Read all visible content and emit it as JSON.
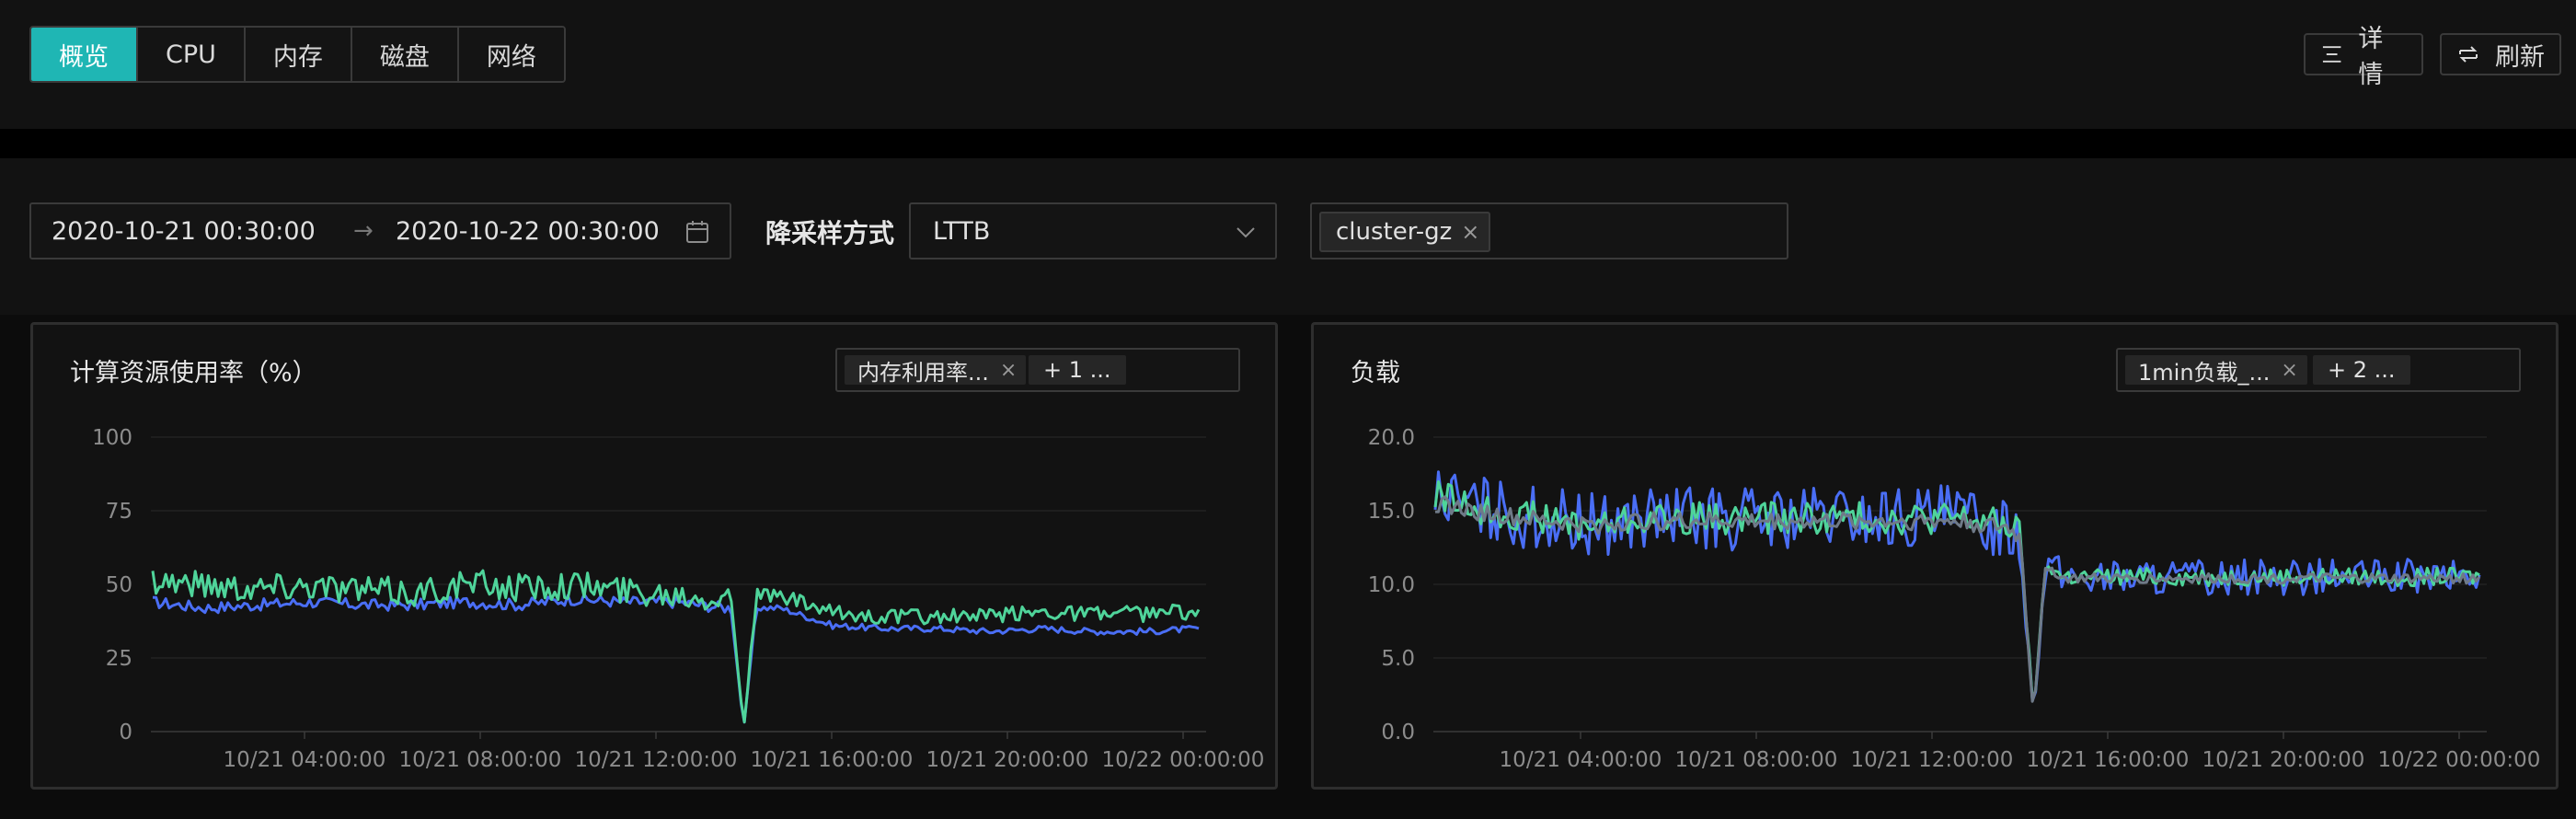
{
  "tabs": [
    {
      "label": "概览",
      "active": true
    },
    {
      "label": "CPU",
      "active": false
    },
    {
      "label": "内存",
      "active": false
    },
    {
      "label": "磁盘",
      "active": false
    },
    {
      "label": "网络",
      "active": false
    }
  ],
  "actions": {
    "detail_label": "详情",
    "refresh_label": "刷新"
  },
  "filters": {
    "start": "2020-10-21 00:30:00",
    "arrow": "→",
    "end": "2020-10-22 00:30:00",
    "sampling_label": "降采样方式",
    "sampling_value": "LTTB",
    "cluster_tag": "cluster-gz"
  },
  "colors": {
    "accent": "#1fb6b4",
    "blue": "#4a6ef5",
    "green": "#4fd49a",
    "gray": "#6f7a88"
  },
  "chart_data": [
    {
      "type": "line",
      "title": "计算资源使用率（%）",
      "metric_tag": "内存利用率...",
      "more_tag": "+ 1 ...",
      "x_ticks": [
        "10/21 04:00:00",
        "10/21 08:00:00",
        "10/21 12:00:00",
        "10/21 16:00:00",
        "10/21 20:00:00",
        "10/22 00:00:00"
      ],
      "y_ticks": [
        "100",
        "75",
        "50",
        "25",
        "0"
      ],
      "ylim": [
        0,
        100
      ],
      "series": [
        {
          "color": "#4a6ef5",
          "base": [
            44,
            42,
            43,
            44,
            43,
            43,
            44,
            43,
            45,
            44,
            44,
            42,
            42,
            36,
            35,
            35,
            34,
            35,
            34,
            34,
            35
          ],
          "noise": 2
        },
        {
          "color": "#4fd49a",
          "base": [
            52,
            50,
            49,
            50,
            48,
            47,
            50,
            49,
            50,
            48,
            47,
            46,
            46,
            40,
            39,
            39,
            39,
            41,
            40,
            40,
            41
          ],
          "noise": 5
        }
      ],
      "dip": {
        "at": 0.565,
        "value": 1
      }
    },
    {
      "type": "line",
      "title": "负载",
      "metric_tag": "1min负载_...",
      "more_tag": "+ 2 ...",
      "x_ticks": [
        "10/21 04:00:00",
        "10/21 08:00:00",
        "10/21 12:00:00",
        "10/21 16:00:00",
        "10/21 20:00:00",
        "10/22 00:00:00"
      ],
      "y_ticks": [
        "20.0",
        "15.0",
        "10.0",
        "5.0",
        "0.0"
      ],
      "ylim": [
        0,
        20
      ],
      "series": [
        {
          "color": "#4a6ef5",
          "base": [
            16,
            15,
            14.5,
            14,
            14.5,
            14.5,
            14.5,
            14.5,
            14.5,
            14.5,
            14.5,
            14,
            10.5,
            10.5,
            10.5,
            10.5,
            10.5,
            10.5,
            10.5,
            10.5,
            10.5
          ],
          "noise": 2.2
        },
        {
          "color": "#4fd49a",
          "base": [
            16,
            15,
            14.5,
            14,
            14.5,
            14.5,
            14.5,
            14.5,
            14.5,
            14.5,
            14.5,
            14,
            10.5,
            10.5,
            10.5,
            10.5,
            10.5,
            10.5,
            10.5,
            10.5,
            10.5
          ],
          "noise": 1.1
        },
        {
          "color": "#6f7a88",
          "base": [
            15.5,
            14.8,
            14.3,
            14,
            14.3,
            14.3,
            14.3,
            14.3,
            14.3,
            14.3,
            14.3,
            13.8,
            10.4,
            10.4,
            10.4,
            10.4,
            10.4,
            10.4,
            10.4,
            10.4,
            10.4
          ],
          "noise": 0.6
        }
      ],
      "dip": {
        "at": 0.573,
        "value": 1
      }
    }
  ]
}
